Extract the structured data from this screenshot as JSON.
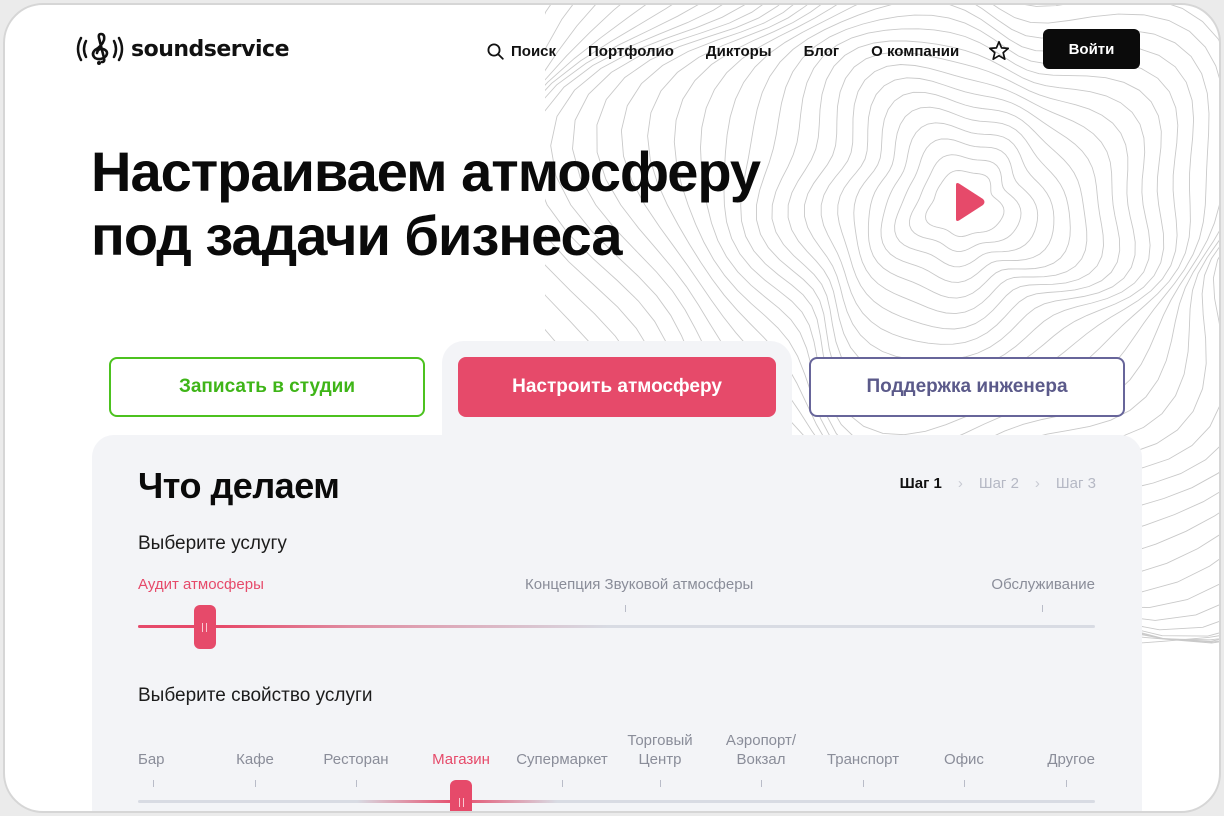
{
  "header": {
    "logo_text": "soundservice",
    "nav": {
      "search": "Поиск",
      "portfolio": "Портфолио",
      "voices": "Дикторы",
      "blog": "Блог",
      "about": "О компании"
    },
    "login_label": "Войти"
  },
  "hero": {
    "title_line1": "Настраиваем атмосферу",
    "title_line2": "под задачи бизнеса"
  },
  "tabs": {
    "record": "Записать в студии",
    "atmosphere": "Настроить атмосферу",
    "support": "Поддержка инженера"
  },
  "panel": {
    "title": "Что делаем",
    "steps": [
      "Шаг 1",
      "Шаг 2",
      "Шаг 3"
    ],
    "service": {
      "label": "Выберите услугу",
      "options": [
        "Аудит атмосферы",
        "Концепция Звуковой атмосферы",
        "Обслуживание"
      ],
      "selected_index": 0,
      "value_fraction": 0.07
    },
    "property": {
      "label": "Выберите свойство услуги",
      "options": [
        "Бар",
        "Кафе",
        "Ресторан",
        "Магазин",
        "Супермаркет",
        "Торговый Центр",
        "Аэропорт/ Вокзал",
        "Транспорт",
        "Офис",
        "Другое"
      ],
      "option_lines": [
        [
          "Бар"
        ],
        [
          "Кафе"
        ],
        [
          "Ресторан"
        ],
        [
          "Магазин"
        ],
        [
          "Супермаркет"
        ],
        [
          "Торговый",
          "Центр"
        ],
        [
          "Аэропорт/",
          "Вокзал"
        ],
        [
          "Транспорт"
        ],
        [
          "Офис"
        ],
        [
          "Другое"
        ]
      ],
      "selected_index": 3
    }
  },
  "colors": {
    "accent": "#e64a6a",
    "green": "#4cc21f",
    "indigo": "#67659a",
    "panel_bg": "#f3f4f7",
    "dark": "#0b0b0b"
  }
}
